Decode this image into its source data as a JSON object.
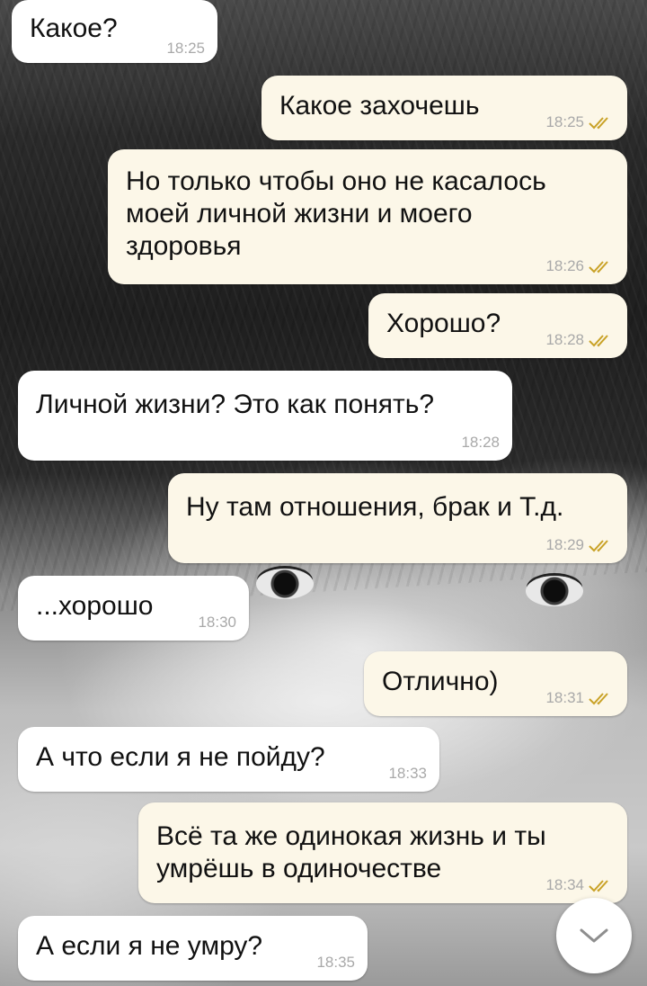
{
  "messages": [
    {
      "text": "Какое?",
      "time": "18:25",
      "direction": "in"
    },
    {
      "text": "Какое захочешь",
      "time": "18:25",
      "direction": "out",
      "status": "read"
    },
    {
      "text": "Но только чтобы оно не касалось\nмоей личной жизни и моего\nздоровья",
      "time": "18:26",
      "direction": "out",
      "status": "read"
    },
    {
      "text": "Хорошо?",
      "time": "18:28",
      "direction": "out",
      "status": "read"
    },
    {
      "text": "Личной жизни? Это как понять?",
      "time": "18:28",
      "direction": "in"
    },
    {
      "text": "Ну там отношения, брак и Т.д.",
      "time": "18:29",
      "direction": "out",
      "status": "read"
    },
    {
      "text": "...хорошо",
      "time": "18:30",
      "direction": "in"
    },
    {
      "text": "Отлично)",
      "time": "18:31",
      "direction": "out",
      "status": "read"
    },
    {
      "text": "А что если я не пойду?",
      "time": "18:33",
      "direction": "in"
    },
    {
      "text": "Всё та же одинокая жизнь и ты\nумрёшь в одиночестве",
      "time": "18:34",
      "direction": "out",
      "status": "read"
    },
    {
      "text": "А если я не умру?",
      "time": "18:35",
      "direction": "in"
    }
  ],
  "colors": {
    "incoming_bubble": "#ffffff",
    "outgoing_bubble": "#fcf7e8",
    "read_ticks": "#c9a227",
    "timestamp": "#a9a9a9"
  },
  "icons": {
    "read_status": "double-check-icon",
    "scroll_down": "chevron-down-icon"
  }
}
